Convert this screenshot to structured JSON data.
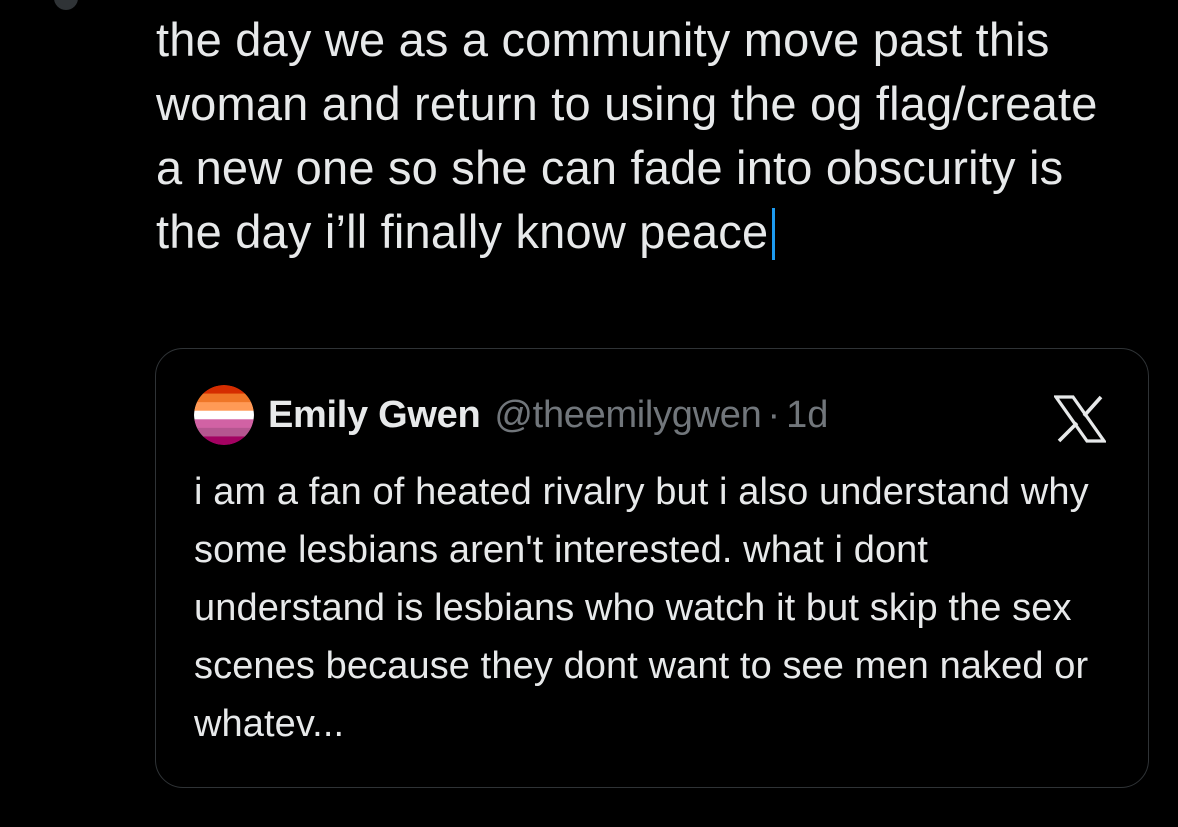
{
  "compose": {
    "text": "the day we as a community move past this woman and return to using the og flag/create a new one so she can fade into obscurity is the day i’ll finally know peace"
  },
  "quoted_tweet": {
    "display_name": "Emily Gwen",
    "handle": "@theemilygwen",
    "separator": "·",
    "timestamp": "1d",
    "body": "i am a fan of heated rivalry but i also understand why some lesbians aren't interested. what i dont understand is lesbians who watch it but skip the sex scenes because they dont want to see men naked or whatev...",
    "avatar_icon": "lesbian-flag-avatar",
    "platform_icon": "x-logo-icon"
  },
  "colors": {
    "background": "#000000",
    "text": "#e7e9ea",
    "muted": "#71767b",
    "border": "#2f3336",
    "caret": "#1d9bf0",
    "flag": [
      "#d52d00",
      "#ef7627",
      "#ff9a56",
      "#ffffff",
      "#d162a4",
      "#b55690",
      "#a30262"
    ]
  }
}
